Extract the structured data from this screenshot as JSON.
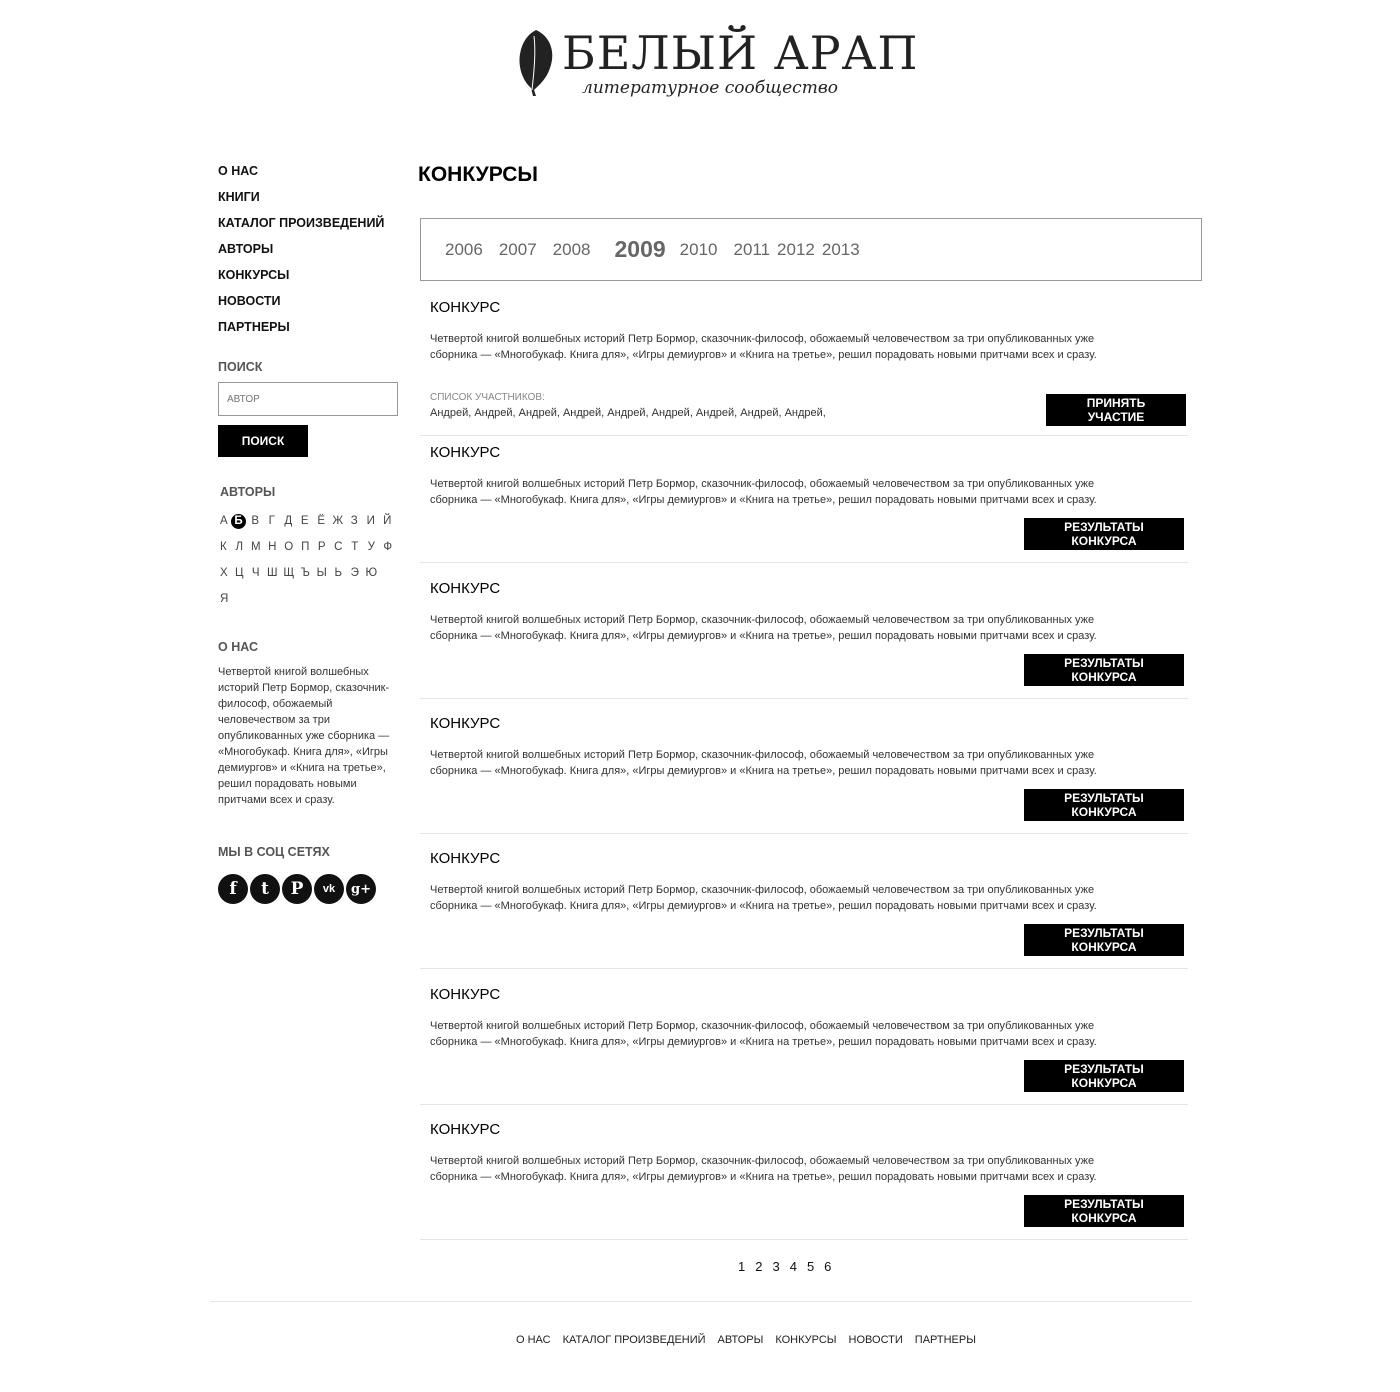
{
  "logo": {
    "title": "БЕЛЫЙ АРАП",
    "subtitle": "литературное сообщество"
  },
  "nav": [
    "О НАС",
    "КНИГИ",
    "КАТАЛОГ ПРОИЗВЕДЕНИЙ",
    "АВТОРЫ",
    "КОНКУРСЫ",
    "НОВОСТИ",
    "ПАРТНЕРЫ"
  ],
  "search": {
    "title": "ПОИСК",
    "placeholder": "АВТОР",
    "button": "ПОИСК"
  },
  "authors": {
    "title": "АВТОРЫ",
    "active": "Б",
    "rows": [
      [
        "А",
        "Б",
        "В",
        "Г",
        "Д",
        "Е",
        "Ё",
        "Ж",
        "З",
        "И",
        "Й"
      ],
      [
        "К",
        "Л",
        "М",
        "Н",
        "О",
        "П",
        "Р",
        "С",
        "Т",
        "У",
        "Ф"
      ],
      [
        "Х",
        "Ц",
        "Ч",
        "Ш",
        "Щ",
        "Ъ",
        "Ы",
        "Ь",
        "Э",
        "Ю"
      ],
      [
        "Я"
      ]
    ]
  },
  "about": {
    "title": "О НАС",
    "text": "Четвертой книгой волшебных историй Петр Бормор, сказочник-философ, обожаемый человечеством за три опубликованных уже сборника — «Многобукаф. Книга для», «Игры демиургов» и «Книга на третье», решил порадовать новыми притчами всех и сразу."
  },
  "social": {
    "title": "МЫ В СОЦ СЕТЯХ",
    "icons": [
      {
        "name": "facebook-icon",
        "glyph": "f"
      },
      {
        "name": "twitter-icon",
        "glyph": "t"
      },
      {
        "name": "pinterest-icon",
        "glyph": "P"
      },
      {
        "name": "vk-icon",
        "glyph": "vk"
      },
      {
        "name": "google-plus-icon",
        "glyph": "g+"
      }
    ]
  },
  "main": {
    "title": "КОНКУРСЫ",
    "years": [
      "2006",
      "2007",
      "2008",
      "2009",
      "2010",
      "2011",
      "2012",
      "2013"
    ],
    "active_year": "2009",
    "contests": [
      {
        "title": "КОНКУРС",
        "text": "Четвертой книгой волшебных историй Петр Бормор, сказочник-философ, обожаемый человечеством за три опубликованных уже сборника — «Многобукаф. Книга для», «Игры демиургов» и «Книга на третье», решил порадовать новыми притчами всех и сразу.",
        "participants_label": "СПИСОК УЧАСТНИКОВ:",
        "participants": "Андрей, Андрей, Андрей, Андрей, Андрей, Андрей, Андрей, Андрей, Андрей,",
        "button": "ПРИНЯТЬ УЧАСТИЕ"
      },
      {
        "title": "КОНКУРС",
        "text": "Четвертой книгой волшебных историй Петр Бормор, сказочник-философ, обожаемый человечеством за три опубликованных уже сборника — «Многобукаф. Книга для», «Игры демиургов» и «Книга на третье», решил порадовать новыми притчами всех и сразу.",
        "button": "РЕЗУЛЬТАТЫ КОНКУРСА"
      },
      {
        "title": "КОНКУРС",
        "text": "Четвертой книгой волшебных историй Петр Бормор, сказочник-философ, обожаемый человечеством за три опубликованных уже сборника — «Многобукаф. Книга для», «Игры демиургов» и «Книга на третье», решил порадовать новыми притчами всех и сразу.",
        "button": "РЕЗУЛЬТАТЫ КОНКУРСА"
      },
      {
        "title": "КОНКУРС",
        "text": "Четвертой книгой волшебных историй Петр Бормор, сказочник-философ, обожаемый человечеством за три опубликованных уже сборника — «Многобукаф. Книга для», «Игры демиургов» и «Книга на третье», решил порадовать новыми притчами всех и сразу.",
        "button": "РЕЗУЛЬТАТЫ КОНКУРСА"
      },
      {
        "title": "КОНКУРС",
        "text": "Четвертой книгой волшебных историй Петр Бормор, сказочник-философ, обожаемый человечеством за три опубликованных уже сборника — «Многобукаф. Книга для», «Игры демиургов» и «Книга на третье», решил порадовать новыми притчами всех и сразу.",
        "button": "РЕЗУЛЬТАТЫ КОНКУРСА"
      },
      {
        "title": "КОНКУРС",
        "text": "Четвертой книгой волшебных историй Петр Бормор, сказочник-философ, обожаемый человечеством за три опубликованных уже сборника — «Многобукаф. Книга для», «Игры демиургов» и «Книга на третье», решил порадовать новыми притчами всех и сразу.",
        "button": "РЕЗУЛЬТАТЫ КОНКУРСА"
      },
      {
        "title": "КОНКУРС",
        "text": "Четвертой книгой волшебных историй Петр Бормор, сказочник-философ, обожаемый человечеством за три опубликованных уже сборника — «Многобукаф. Книга для», «Игры демиургов» и «Книга на третье», решил порадовать новыми притчами всех и сразу.",
        "button": "РЕЗУЛЬТАТЫ КОНКУРСА"
      }
    ],
    "pages": [
      "1",
      "2",
      "3",
      "4",
      "5",
      "6"
    ]
  },
  "footer": {
    "links": [
      "О НАС",
      "КАТАЛОГ ПРОИЗВЕДЕНИЙ",
      "АВТОРЫ",
      "КОНКУРСЫ",
      "НОВОСТИ",
      "ПАРТНЕРЫ"
    ]
  }
}
